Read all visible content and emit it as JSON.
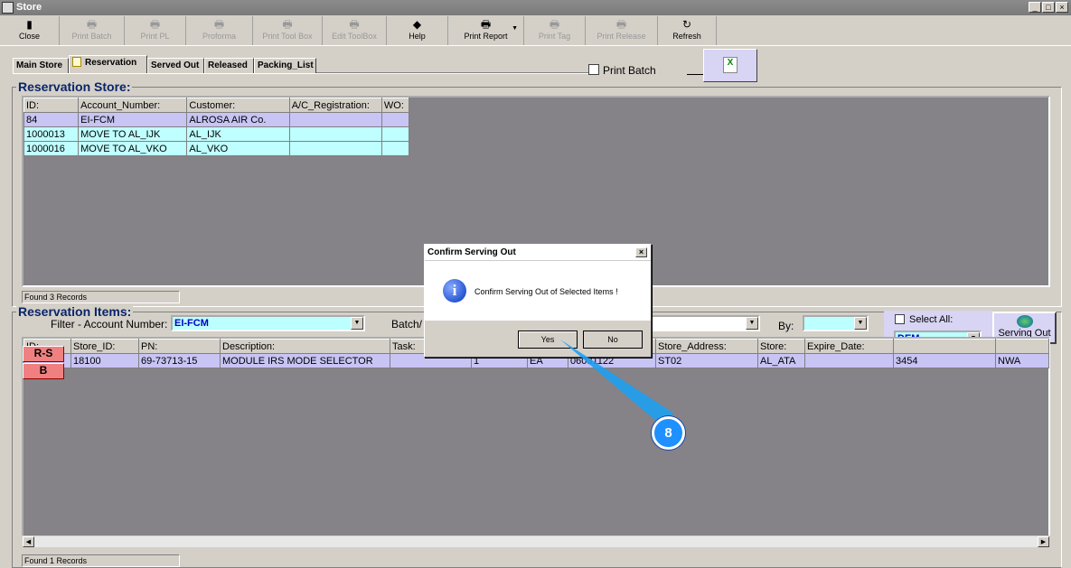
{
  "window": {
    "title": "Store",
    "controls": [
      "_",
      "□",
      "×"
    ]
  },
  "toolbar": [
    {
      "label": "Close",
      "icon": "door-exit-icon",
      "enabled": true
    },
    {
      "label": "Print Batch",
      "icon": "printer-icon",
      "enabled": false
    },
    {
      "label": "Print PL",
      "icon": "printer-icon",
      "enabled": false
    },
    {
      "label": "Proforma",
      "icon": "printer-icon",
      "enabled": false
    },
    {
      "label": "Print Tool Box",
      "icon": "printer-icon",
      "enabled": false
    },
    {
      "label": "Edit ToolBox",
      "icon": "printer-icon",
      "enabled": false
    },
    {
      "label": "Help",
      "icon": "help-book-icon",
      "enabled": true
    },
    {
      "label": "Print Report",
      "icon": "printer-icon",
      "enabled": true
    },
    {
      "label": "Print Tag",
      "icon": "printer-icon",
      "enabled": false
    },
    {
      "label": "Print Release",
      "icon": "printer-icon",
      "enabled": false
    },
    {
      "label": "Refresh",
      "icon": "refresh-icon",
      "enabled": true
    }
  ],
  "tabs": [
    "Main Store",
    "Reservation",
    "Served Out",
    "Released",
    "Packing_List"
  ],
  "print_batch_label": "Print Batch",
  "reservation_store": {
    "title": "Reservation Store:",
    "columns": [
      "ID:",
      "Account_Number:",
      "Customer:",
      "A/C_Registration:",
      "WO:"
    ],
    "rows": [
      [
        "84",
        "EI-FCM",
        "ALROSA AIR Co.",
        "",
        ""
      ],
      [
        "1000013",
        "MOVE TO AL_IJK",
        "AL_IJK",
        "",
        ""
      ],
      [
        "1000016",
        "MOVE TO AL_VKO",
        "AL_VKO",
        "",
        ""
      ]
    ],
    "status": "Found 3 Records"
  },
  "reservation_items": {
    "title": "Reservation Items:",
    "filter_label": "Filter - Account Number:",
    "filter_value": "EI-FCM",
    "batch_label": "Batch/",
    "by_label": "By:",
    "select_all_label": "Select All:",
    "dem_value": "DEM",
    "serving_out_label": "Serving Out",
    "rs_button": "R-S",
    "b_button": "B",
    "columns": [
      "ID:",
      "Store_ID:",
      "PN:",
      "Description:",
      "Task:",
      "",
      "",
      "",
      "Store_Address:",
      "Store:",
      "Expire_Date:",
      "",
      ""
    ],
    "rows": [
      [
        "",
        "18100",
        "69-73713-15",
        "MODULE IRS MODE SELECTOR",
        "",
        "1",
        "EA",
        "06031122",
        "ST02",
        "AL_ATA",
        "",
        "3454",
        "NWA"
      ]
    ],
    "status": "Found 1 Records"
  },
  "dialog": {
    "title": "Confirm Serving Out",
    "message": "Confirm Serving Out of Selected Items !",
    "yes": "Yes",
    "no": "No"
  },
  "callout": {
    "number": "8",
    "color": "#1e90ff"
  }
}
